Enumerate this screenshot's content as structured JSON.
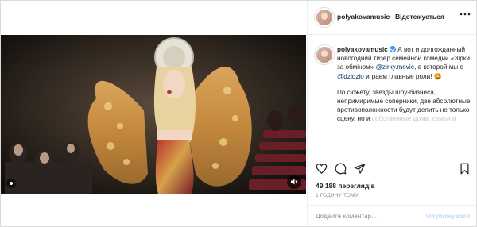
{
  "post": {
    "username": "polyakovamusic",
    "separator": "•",
    "follow_label": "Відстежується",
    "caption": {
      "author": "polyakovamusic",
      "text_1": " А вот и долгожданный новогодний тизер семейной комедии «Зірки за обміном» ",
      "mention_1": "@zirky.movie",
      "text_2": ", в которой мы с ",
      "mention_2": "@dzidzio",
      "text_3": " играем главные роли! ",
      "emoji": "🤩",
      "paragraph_2": "По сюжету, звезды шоу-бизнеса, непримиримые соперники, две абсолютные противоположности будут делить не только сцену, но и",
      "paragraph_2_faded": "собственные дома, семьи и"
    },
    "views": "49 188 переглядів",
    "time_ago": "1 ГОДИНУ ТОМУ",
    "comment_placeholder": "Додайте коментар...",
    "publish_label": "Опублікувати"
  },
  "icons": {
    "more": "more-horizontal-icon",
    "like": "heart-icon",
    "comment": "comment-icon",
    "share": "share-icon",
    "save": "bookmark-icon",
    "mute": "mute-icon",
    "verified": "verified-badge-icon"
  },
  "colors": {
    "text": "#262626",
    "secondary": "#8e8e8e",
    "link": "#00376b",
    "verified": "#3897f0",
    "publish_disabled": "#b3dbff",
    "border": "#dbdbdb"
  }
}
